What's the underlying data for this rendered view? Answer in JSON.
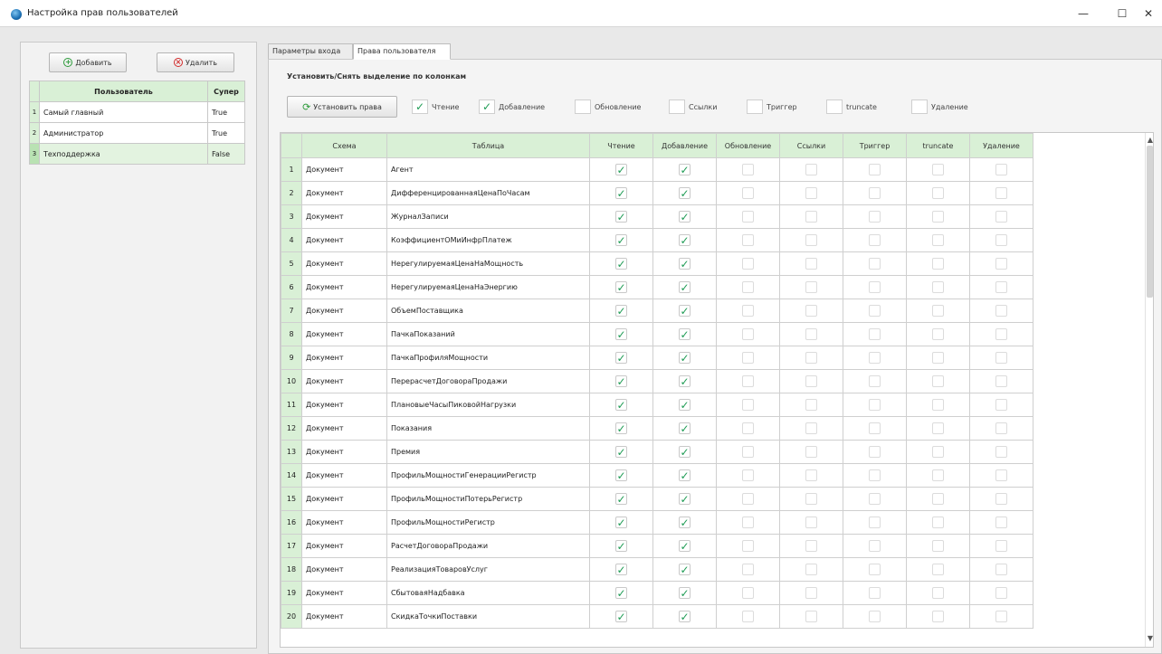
{
  "window": {
    "title": "Настройка прав пользователей",
    "minimize": "—",
    "maximize": "☐",
    "close": "✕"
  },
  "left": {
    "add_label": "Добавить",
    "delete_label": "Удалить",
    "columns": [
      "Пользователь",
      "Супер"
    ],
    "users": [
      {
        "num": "1",
        "name": "Самый главный",
        "super": "True"
      },
      {
        "num": "2",
        "name": "Администратор",
        "super": "True"
      },
      {
        "num": "3",
        "name": "Техподдержка",
        "super": "False",
        "selected": true
      }
    ]
  },
  "tabs": [
    {
      "label": "Параметры входа",
      "active": false
    },
    {
      "label": "Права пользователя",
      "active": true
    }
  ],
  "rights": {
    "group_title": "Установить/Снять выделение по колонкам",
    "set_button": "Установить права",
    "column_toggles": [
      {
        "label": "Чтение",
        "checked": true
      },
      {
        "label": "Добавление",
        "checked": true
      },
      {
        "label": "Обновление",
        "checked": false
      },
      {
        "label": "Ссылки",
        "checked": false
      },
      {
        "label": "Триггер",
        "checked": false
      },
      {
        "label": "truncate",
        "checked": false
      },
      {
        "label": "Удаление",
        "checked": false
      }
    ],
    "columns": [
      "Схема",
      "Таблица",
      "Чтение",
      "Добавление",
      "Обновление",
      "Ссылки",
      "Триггер",
      "truncate",
      "Удаление"
    ],
    "rows": [
      {
        "num": "1",
        "schema": "Документ",
        "table": "Агент"
      },
      {
        "num": "2",
        "schema": "Документ",
        "table": "ДифференцированнаяЦенаПоЧасам"
      },
      {
        "num": "3",
        "schema": "Документ",
        "table": "ЖурналЗаписи"
      },
      {
        "num": "4",
        "schema": "Документ",
        "table": "КоэффициентОМиИнфрПлатеж"
      },
      {
        "num": "5",
        "schema": "Документ",
        "table": "НерегулируемаяЦенаНаМощность"
      },
      {
        "num": "6",
        "schema": "Документ",
        "table": "НерегулируемаяЦенаНаЭнергию"
      },
      {
        "num": "7",
        "schema": "Документ",
        "table": "ОбъемПоставщика"
      },
      {
        "num": "8",
        "schema": "Документ",
        "table": "ПачкаПоказаний"
      },
      {
        "num": "9",
        "schema": "Документ",
        "table": "ПачкаПрофиляМощности"
      },
      {
        "num": "10",
        "schema": "Документ",
        "table": "ПерерасчетДоговораПродажи"
      },
      {
        "num": "11",
        "schema": "Документ",
        "table": "ПлановыеЧасыПиковойНагрузки"
      },
      {
        "num": "12",
        "schema": "Документ",
        "table": "Показания"
      },
      {
        "num": "13",
        "schema": "Документ",
        "table": "Премия"
      },
      {
        "num": "14",
        "schema": "Документ",
        "table": "ПрофильМощностиГенерацииРегистр"
      },
      {
        "num": "15",
        "schema": "Документ",
        "table": "ПрофильМощностиПотерьРегистр"
      },
      {
        "num": "16",
        "schema": "Документ",
        "table": "ПрофильМощностиРегистр"
      },
      {
        "num": "17",
        "schema": "Документ",
        "table": "РасчетДоговораПродажи"
      },
      {
        "num": "18",
        "schema": "Документ",
        "table": "РеализацияТоваровУслуг"
      },
      {
        "num": "19",
        "schema": "Документ",
        "table": "СбытоваяНадбавка"
      },
      {
        "num": "20",
        "schema": "Документ",
        "table": "СкидкаТочкиПоставки"
      }
    ],
    "row_checks": [
      true,
      true,
      false,
      false,
      false,
      false,
      false
    ]
  },
  "scrollbar": {
    "up": "▲",
    "down": "▼"
  }
}
